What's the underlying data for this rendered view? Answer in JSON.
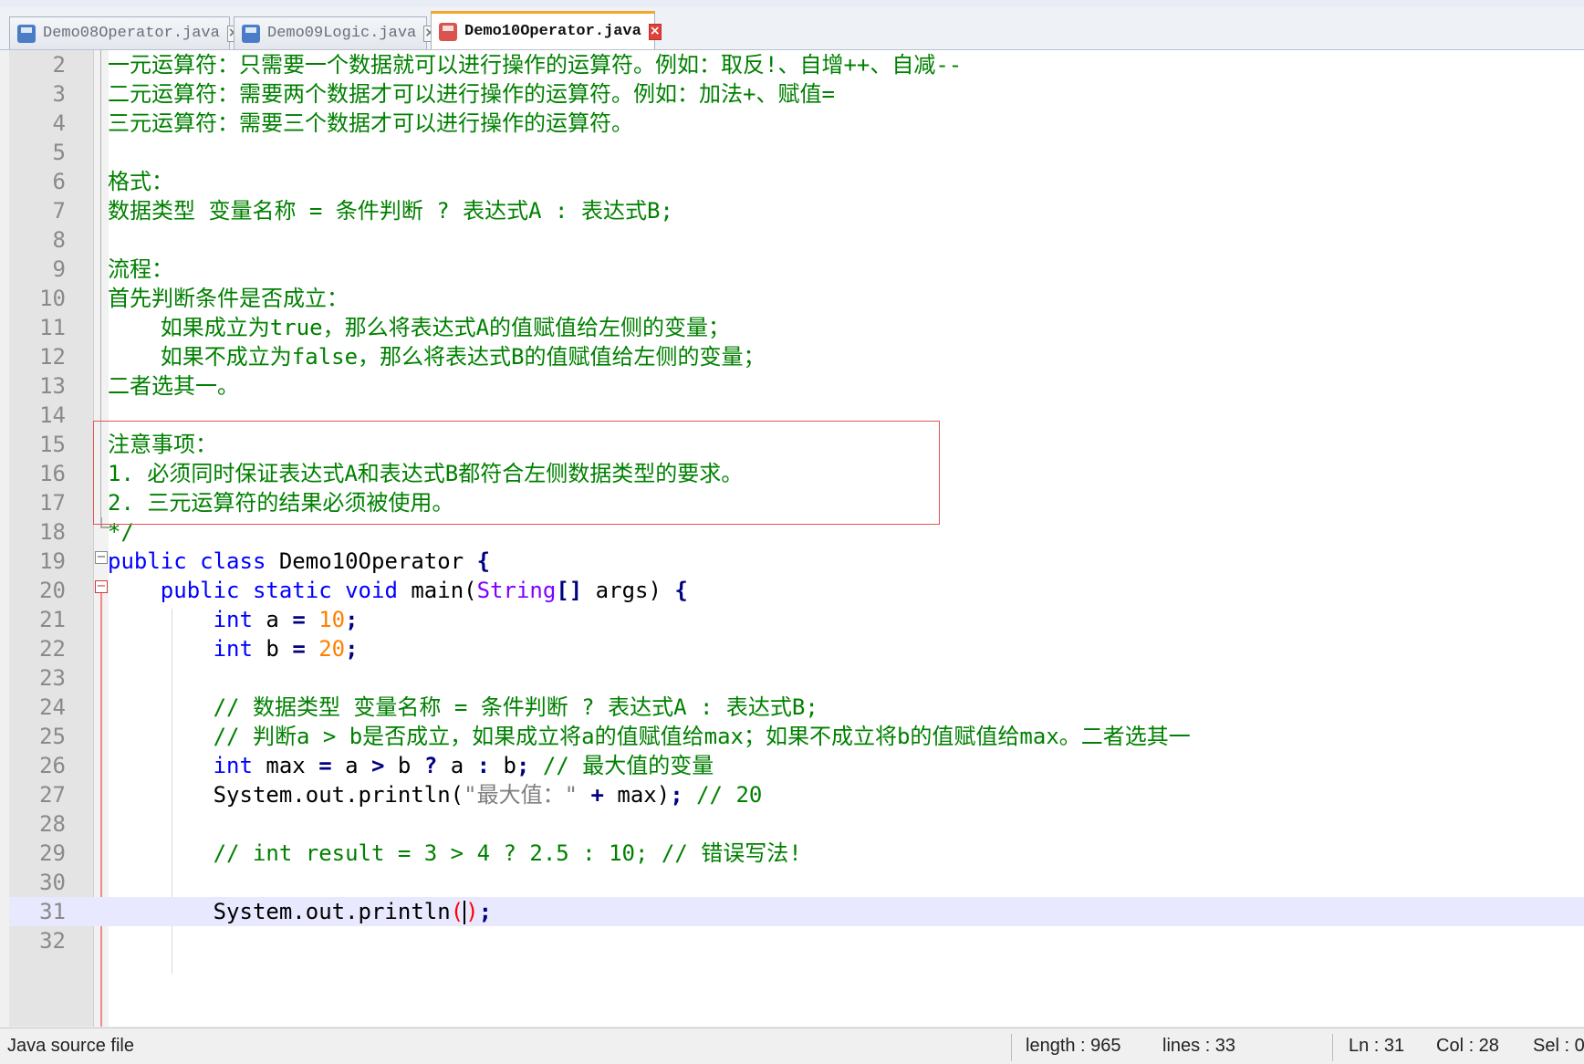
{
  "tabs": [
    {
      "label": "Demo08Operator.java",
      "state": "saved",
      "active": false
    },
    {
      "label": "Demo09Logic.java",
      "state": "saved",
      "active": false
    },
    {
      "label": "Demo10Operator.java",
      "state": "unsaved",
      "active": true
    }
  ],
  "tab_close_glyph": "×",
  "editor": {
    "fold_minus_glyph": "−",
    "lines": {
      "2": "一元运算符：只需要一个数据就可以进行操作的运算符。例如：取反!、自增++、自减--",
      "3": "二元运算符：需要两个数据才可以进行操作的运算符。例如：加法+、赋值=",
      "4": "三元运算符：需要三个数据才可以进行操作的运算符。",
      "6": "格式：",
      "7": "数据类型 变量名称 = 条件判断 ? 表达式A : 表达式B;",
      "9": "流程：",
      "10": "首先判断条件是否成立：",
      "11": "    如果成立为true，那么将表达式A的值赋值给左侧的变量；",
      "12": "    如果不成立为false，那么将表达式B的值赋值给左侧的变量；",
      "13": "二者选其一。",
      "15": "注意事项：",
      "16": "1. 必须同时保证表达式A和表达式B都符合左侧数据类型的要求。",
      "17": "2. 三元运算符的结果必须被使用。",
      "18": "*/",
      "19": {
        "kw1": "public",
        "kw2": "class",
        "name": "Demo10Operator",
        "brace": "{"
      },
      "20": {
        "kw1": "public",
        "kw2": "static",
        "kw3": "void",
        "name": "main(",
        "type": "String",
        "brk": "[]",
        "rest": " args)",
        "brace": "{"
      },
      "21": {
        "kw": "int",
        "var": "a",
        "eq": "=",
        "num": "10",
        "semi": ";"
      },
      "22": {
        "kw": "int",
        "var": "b",
        "eq": "=",
        "num": "20",
        "semi": ";"
      },
      "24": "// 数据类型 变量名称 = 条件判断 ? 表达式A : 表达式B;",
      "25": "// 判断a > b是否成立，如果成立将a的值赋值给max；如果不成立将b的值赋值给max。二者选其一",
      "26": {
        "kw": "int",
        "p1": " max ",
        "eq": "=",
        "p2": "a",
        "gt": ">",
        "p3": " b ",
        "q": "?",
        "p4": " a ",
        "colon": ":",
        "p5": " b",
        "semi": ";",
        "comment": "// 最大值的变量"
      },
      "27": {
        "call": "System.out.println(",
        "str": "\"最大值：\"",
        "plus": "+",
        "arg": " max)",
        "semi": ";",
        "comment": "// 20"
      },
      "29": "// int result = 3 > 4 ? 2.5 : 10; // 错误写法!",
      "31": {
        "call": "System.out.println",
        "lp": "(",
        "rp": ")",
        "semi": ";"
      }
    }
  },
  "status": {
    "file_type": "Java source file",
    "length": "length : 965",
    "lines": "lines : 33",
    "ln": "Ln : 31",
    "col": "Col : 28",
    "sel": "Sel : 0"
  },
  "colors": {
    "comment": "#008000",
    "keyword": "#0000ff",
    "number": "#ff8000",
    "string": "#808080",
    "type": "#8000ff",
    "current_line": "#e8e8ff",
    "highlight_box": "#e05555",
    "active_tab_accent": "#f5a623"
  }
}
